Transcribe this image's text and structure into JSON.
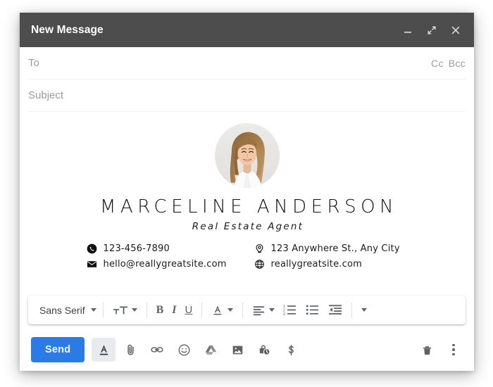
{
  "window": {
    "title": "New Message",
    "controls": [
      {
        "name": "minimize-button",
        "icon": "minimize-icon",
        "label": "Minimize"
      },
      {
        "name": "expand-button",
        "icon": "expand-icon",
        "label": "Full screen"
      },
      {
        "name": "close-button",
        "icon": "close-icon",
        "label": "Save & close"
      }
    ]
  },
  "fields": {
    "to_placeholder": "To",
    "cc_label": "Cc",
    "bcc_label": "Bcc",
    "subject_placeholder": "Subject"
  },
  "signature": {
    "avatar_alt": "Portrait photo of Marceline Anderson",
    "name": "MARCELINE ANDERSON",
    "role": "Real Estate Agent",
    "contacts_left": [
      {
        "icon": "phone-icon",
        "text": "123-456-7890"
      },
      {
        "icon": "envelope-icon",
        "text": "hello@reallygreatsite.com"
      }
    ],
    "contacts_right": [
      {
        "icon": "location-pin-icon",
        "text": "123 Anywhere St., Any City"
      },
      {
        "icon": "globe-icon",
        "text": "reallygreatsite.com"
      }
    ]
  },
  "format_toolbar": {
    "font_value": "Sans Serif",
    "items": [
      {
        "name": "font-family-select",
        "label": "Sans Serif"
      },
      {
        "name": "font-size-button",
        "label": "Size"
      },
      {
        "name": "bold-button",
        "label": "B"
      },
      {
        "name": "italic-button",
        "label": "I"
      },
      {
        "name": "underline-button",
        "label": "U"
      },
      {
        "name": "text-color-button",
        "label": "A"
      },
      {
        "name": "align-button",
        "label": "Align"
      },
      {
        "name": "numbered-list-button",
        "label": "Numbered list"
      },
      {
        "name": "bulleted-list-button",
        "label": "Bulleted list"
      },
      {
        "name": "indent-button",
        "label": "Indent"
      },
      {
        "name": "more-format-button",
        "label": "More"
      }
    ]
  },
  "bottom_bar": {
    "send_label": "Send",
    "tools": [
      {
        "name": "formatting-options-button",
        "icon": "text-format-icon",
        "label": "Formatting options",
        "active": true
      },
      {
        "name": "attach-file-button",
        "icon": "paperclip-icon",
        "label": "Attach files"
      },
      {
        "name": "insert-link-button",
        "icon": "link-icon",
        "label": "Insert link"
      },
      {
        "name": "insert-emoji-button",
        "icon": "emoji-icon",
        "label": "Insert emoji"
      },
      {
        "name": "insert-drive-button",
        "icon": "drive-icon",
        "label": "Insert files using Drive"
      },
      {
        "name": "insert-photo-button",
        "icon": "image-icon",
        "label": "Insert photo"
      },
      {
        "name": "confidential-mode-button",
        "icon": "lock-clock-icon",
        "label": "Confidential mode"
      },
      {
        "name": "insert-money-button",
        "icon": "dollar-icon",
        "label": "Insert money"
      }
    ],
    "right_tools": [
      {
        "name": "discard-draft-button",
        "icon": "trash-icon",
        "label": "Discard draft"
      },
      {
        "name": "more-options-button",
        "icon": "three-dot-icon",
        "label": "More options"
      }
    ]
  },
  "colors": {
    "titlebar_bg": "#4d4d4d",
    "send_blue": "#2a7ae8",
    "placeholder_gray": "#9b9b9b",
    "icon_gray": "#5f6368"
  }
}
